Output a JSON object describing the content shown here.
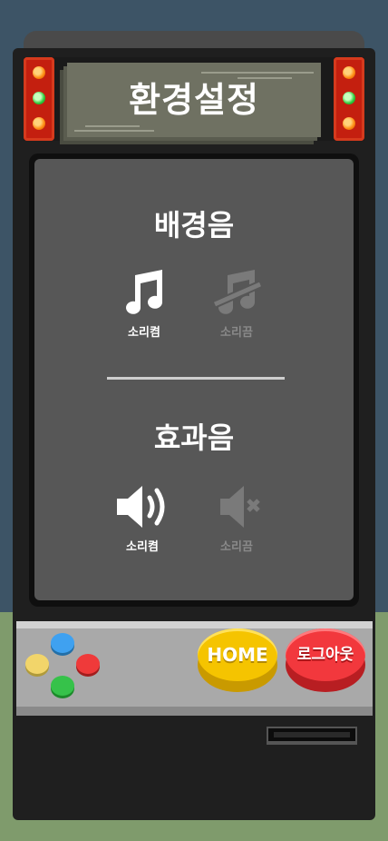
{
  "marquee": {
    "title": "환경설정"
  },
  "bgm": {
    "title": "배경음",
    "on": {
      "label": "소리켬",
      "icon": "music-note-icon",
      "state": "selected"
    },
    "off": {
      "label": "소리끔",
      "icon": "music-off-icon",
      "state": "unselected"
    }
  },
  "sfx": {
    "title": "효과음",
    "on": {
      "label": "소리켬",
      "icon": "speaker-on-icon",
      "state": "selected"
    },
    "off": {
      "label": "소리끔",
      "icon": "speaker-muted-icon",
      "state": "unselected"
    }
  },
  "controls": {
    "home_label": "HOME",
    "logout_label": "로그아웃"
  },
  "colors": {
    "sky": "#3d5466",
    "grass": "#7f9b6c",
    "screen": "#575757",
    "home_button": "#f5c400",
    "logout_button": "#f2383d",
    "lamp_red": "#c41f0f"
  }
}
